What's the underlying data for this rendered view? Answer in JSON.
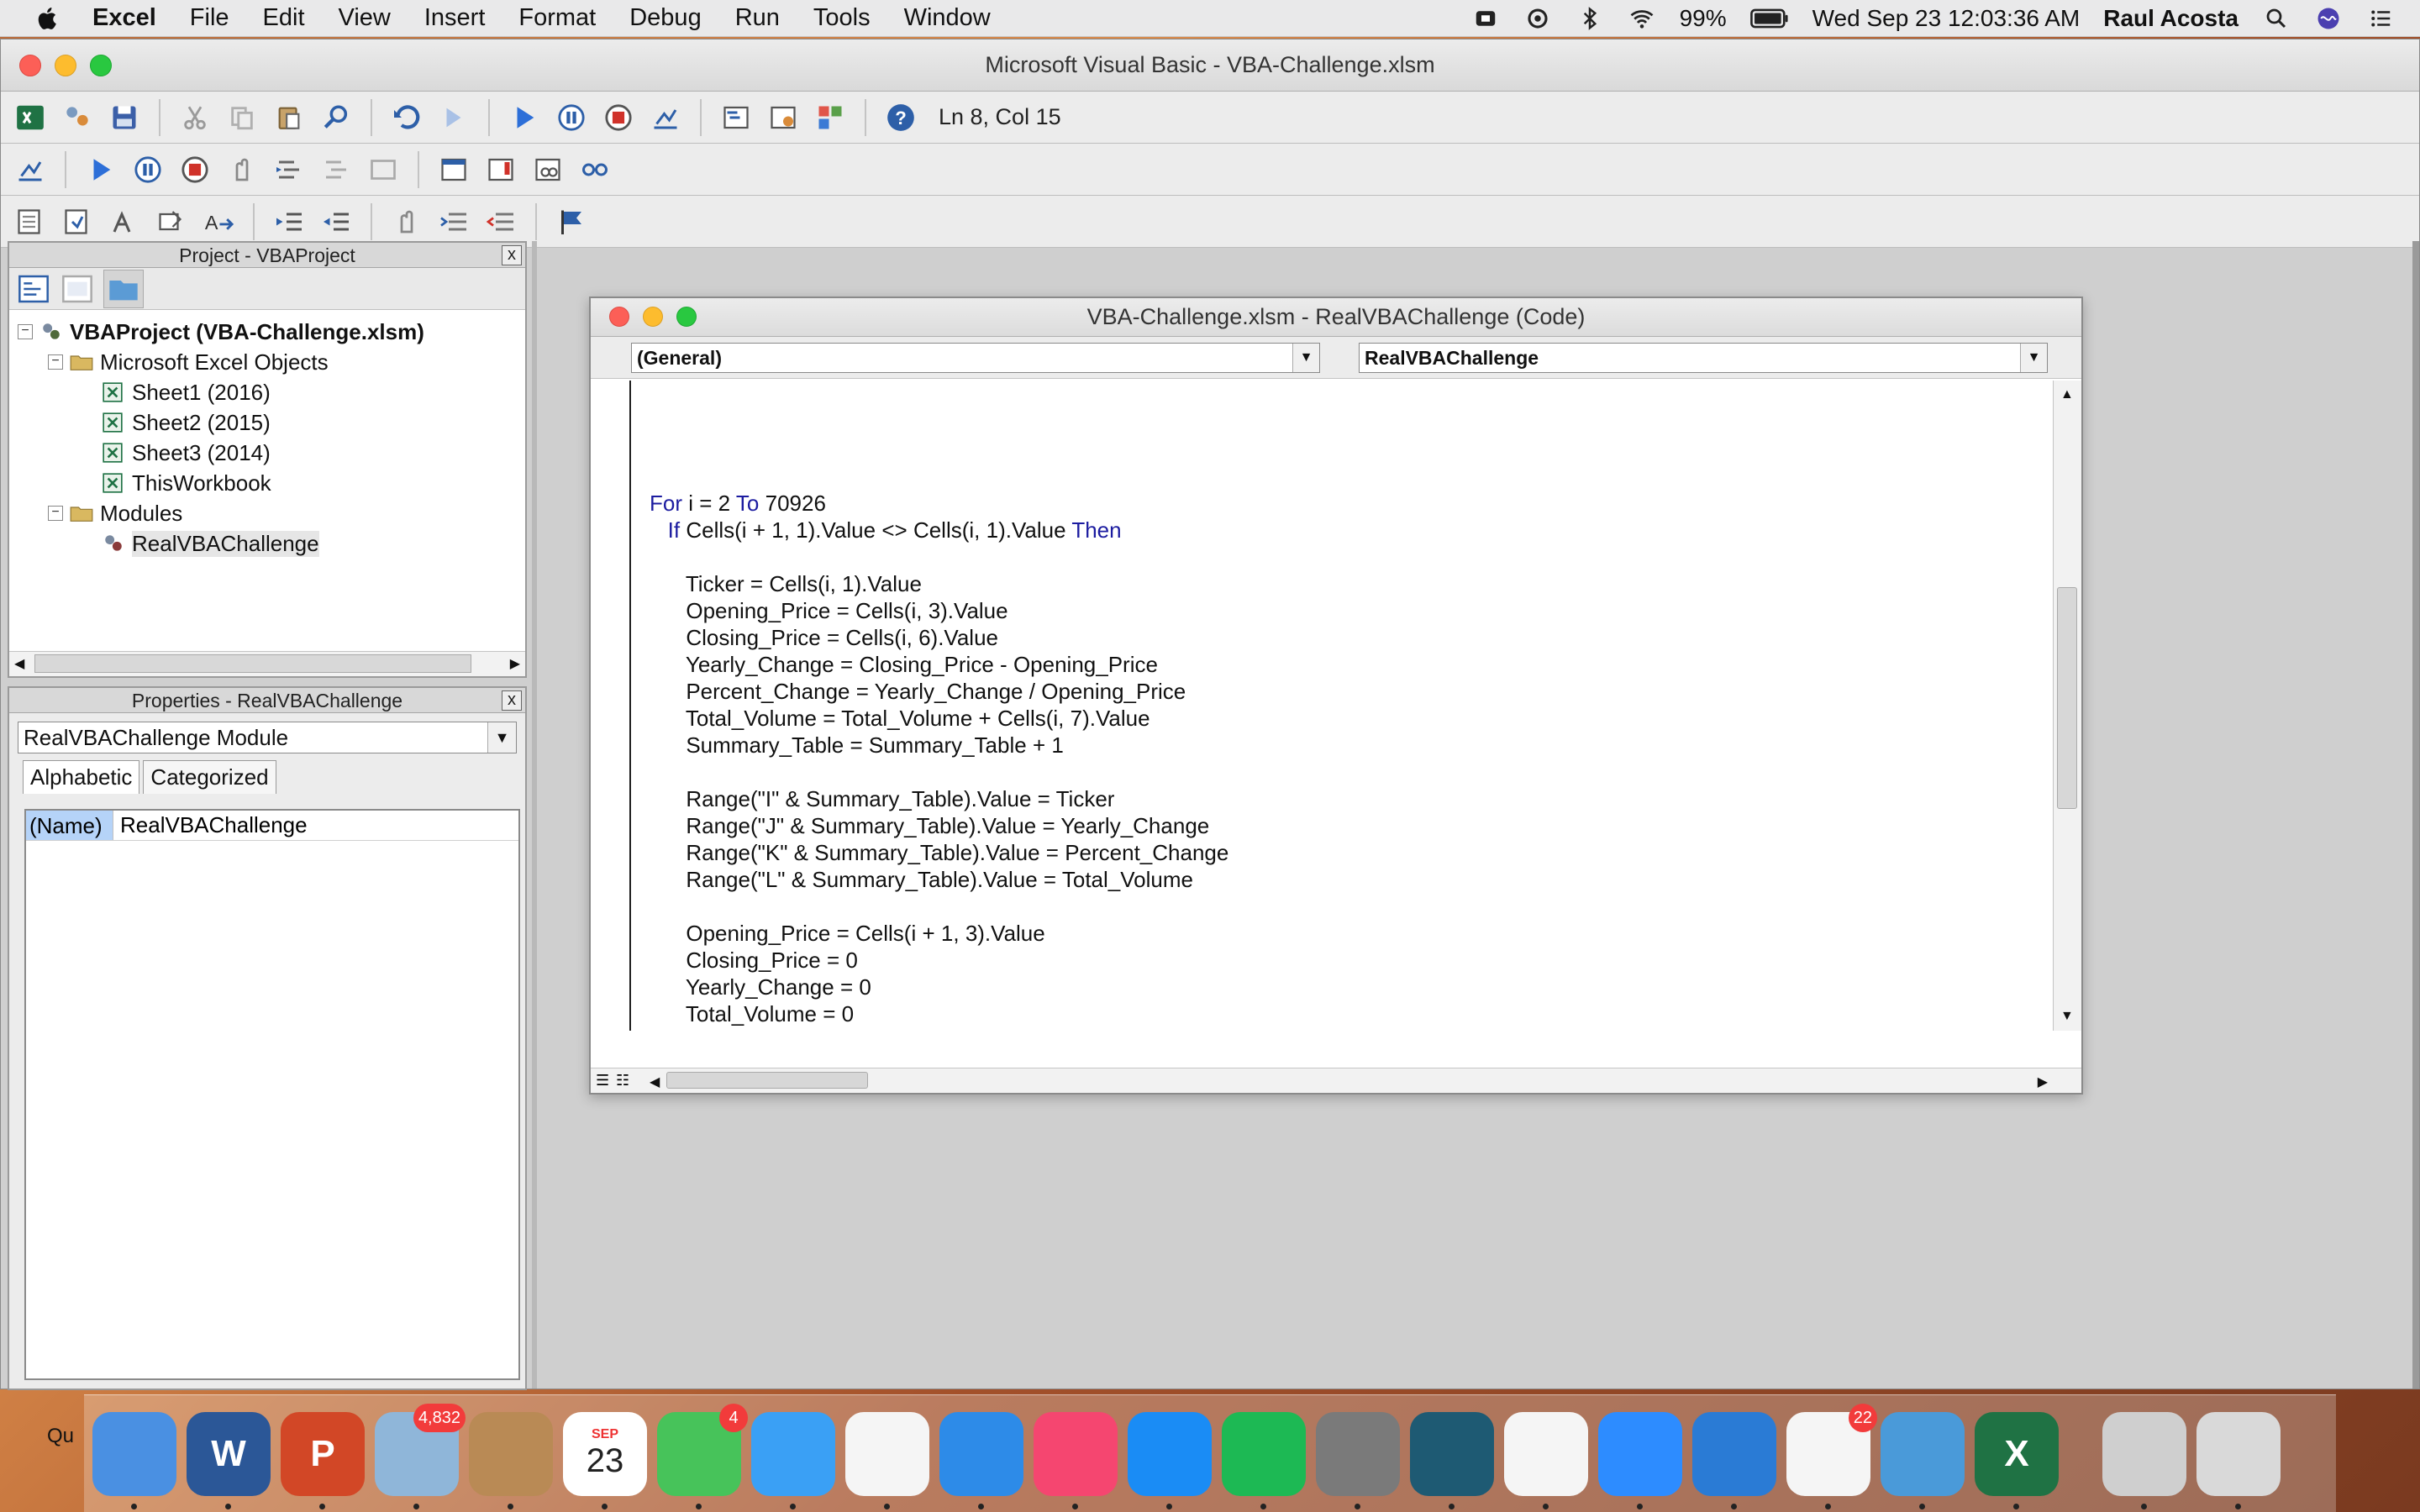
{
  "menubar": {
    "items": [
      "Excel",
      "File",
      "Edit",
      "View",
      "Insert",
      "Format",
      "Debug",
      "Run",
      "Tools",
      "Window"
    ],
    "battery": "99%",
    "datetime": "Wed Sep 23  12:03:36 AM",
    "user": "Raul Acosta"
  },
  "vbe": {
    "title": "Microsoft Visual Basic - VBA-Challenge.xlsm",
    "cursor_status": "Ln 8, Col 15"
  },
  "project": {
    "title": "Project - VBAProject",
    "close": "x",
    "tree": [
      {
        "label": "VBAProject (VBA-Challenge.xlsm)",
        "level": 0,
        "bold": true
      },
      {
        "label": "Microsoft Excel Objects",
        "level": 1
      },
      {
        "label": "Sheet1 (2016)",
        "level": 2
      },
      {
        "label": "Sheet2 (2015)",
        "level": 2
      },
      {
        "label": "Sheet3 (2014)",
        "level": 2
      },
      {
        "label": "ThisWorkbook",
        "level": 2
      },
      {
        "label": "Modules",
        "level": 1
      },
      {
        "label": "RealVBAChallenge",
        "level": 2
      }
    ]
  },
  "properties": {
    "title": "Properties - RealVBAChallenge",
    "close": "x",
    "object": "RealVBAChallenge  Module",
    "tabs": [
      "Alphabetic",
      "Categorized"
    ],
    "rows": [
      {
        "name": "(Name)",
        "value": "RealVBAChallenge"
      }
    ]
  },
  "code_window": {
    "title": "VBA-Challenge.xlsm - RealVBAChallenge (Code)",
    "object_combo": "(General)",
    "proc_combo": "RealVBAChallenge",
    "lines": [
      "For i = 2 To 70926",
      "   If Cells(i + 1, 1).Value <> Cells(i, 1).Value Then",
      "",
      "      Ticker = Cells(i, 1).Value",
      "      Opening_Price = Cells(i, 3).Value",
      "      Closing_Price = Cells(i, 6).Value",
      "      Yearly_Change = Closing_Price - Opening_Price",
      "      Percent_Change = Yearly_Change / Opening_Price",
      "      Total_Volume = Total_Volume + Cells(i, 7).Value",
      "      Summary_Table = Summary_Table + 1",
      "",
      "      Range(\"I\" & Summary_Table).Value = Ticker",
      "      Range(\"J\" & Summary_Table).Value = Yearly_Change",
      "      Range(\"K\" & Summary_Table).Value = Percent_Change",
      "      Range(\"L\" & Summary_Table).Value = Total_Volume",
      "",
      "      Opening_Price = Cells(i + 1, 3).Value",
      "      Closing_Price = 0",
      "      Yearly_Change = 0",
      "      Total_Volume = 0"
    ]
  },
  "dock": {
    "label_left": "Qu",
    "apps": [
      {
        "name": "finder",
        "glyph": "",
        "color": "#4a90e2"
      },
      {
        "name": "word",
        "glyph": "W",
        "color": "#2b5797"
      },
      {
        "name": "powerpoint",
        "glyph": "P",
        "color": "#d24726"
      },
      {
        "name": "mail",
        "glyph": "",
        "color": "#8fb6d9",
        "badge": "4,832"
      },
      {
        "name": "contacts",
        "glyph": "",
        "color": "#b98a55"
      },
      {
        "name": "calendar",
        "glyph": "23",
        "color": "#ffffff"
      },
      {
        "name": "facetime",
        "glyph": "",
        "color": "#47c35a",
        "badge": "4"
      },
      {
        "name": "messages",
        "glyph": "",
        "color": "#3aa0f5"
      },
      {
        "name": "photos",
        "glyph": "",
        "color": "#f5f5f5"
      },
      {
        "name": "safari",
        "glyph": "",
        "color": "#2d8be8"
      },
      {
        "name": "music",
        "glyph": "",
        "color": "#f54670"
      },
      {
        "name": "app-store",
        "glyph": "",
        "color": "#1a8cf5"
      },
      {
        "name": "spotify",
        "glyph": "",
        "color": "#1db954"
      },
      {
        "name": "system-preferences",
        "glyph": "",
        "color": "#7a7a7a"
      },
      {
        "name": "webex",
        "glyph": "",
        "color": "#1e5a73"
      },
      {
        "name": "chrome",
        "glyph": "",
        "color": "#f5f5f5"
      },
      {
        "name": "zoom",
        "glyph": "",
        "color": "#2d8cff"
      },
      {
        "name": "vscode",
        "glyph": "",
        "color": "#2a7bd5"
      },
      {
        "name": "slack",
        "glyph": "",
        "color": "#f5f5f5",
        "badge": "22"
      },
      {
        "name": "preview",
        "glyph": "",
        "color": "#4a9ad9"
      },
      {
        "name": "excel",
        "glyph": "X",
        "color": "#1f7244"
      },
      {
        "name": "downloads-stack",
        "glyph": "",
        "color": "#cfcfcf"
      },
      {
        "name": "trash",
        "glyph": "",
        "color": "#d9d9d9"
      }
    ],
    "calendar_month": "SEP"
  }
}
